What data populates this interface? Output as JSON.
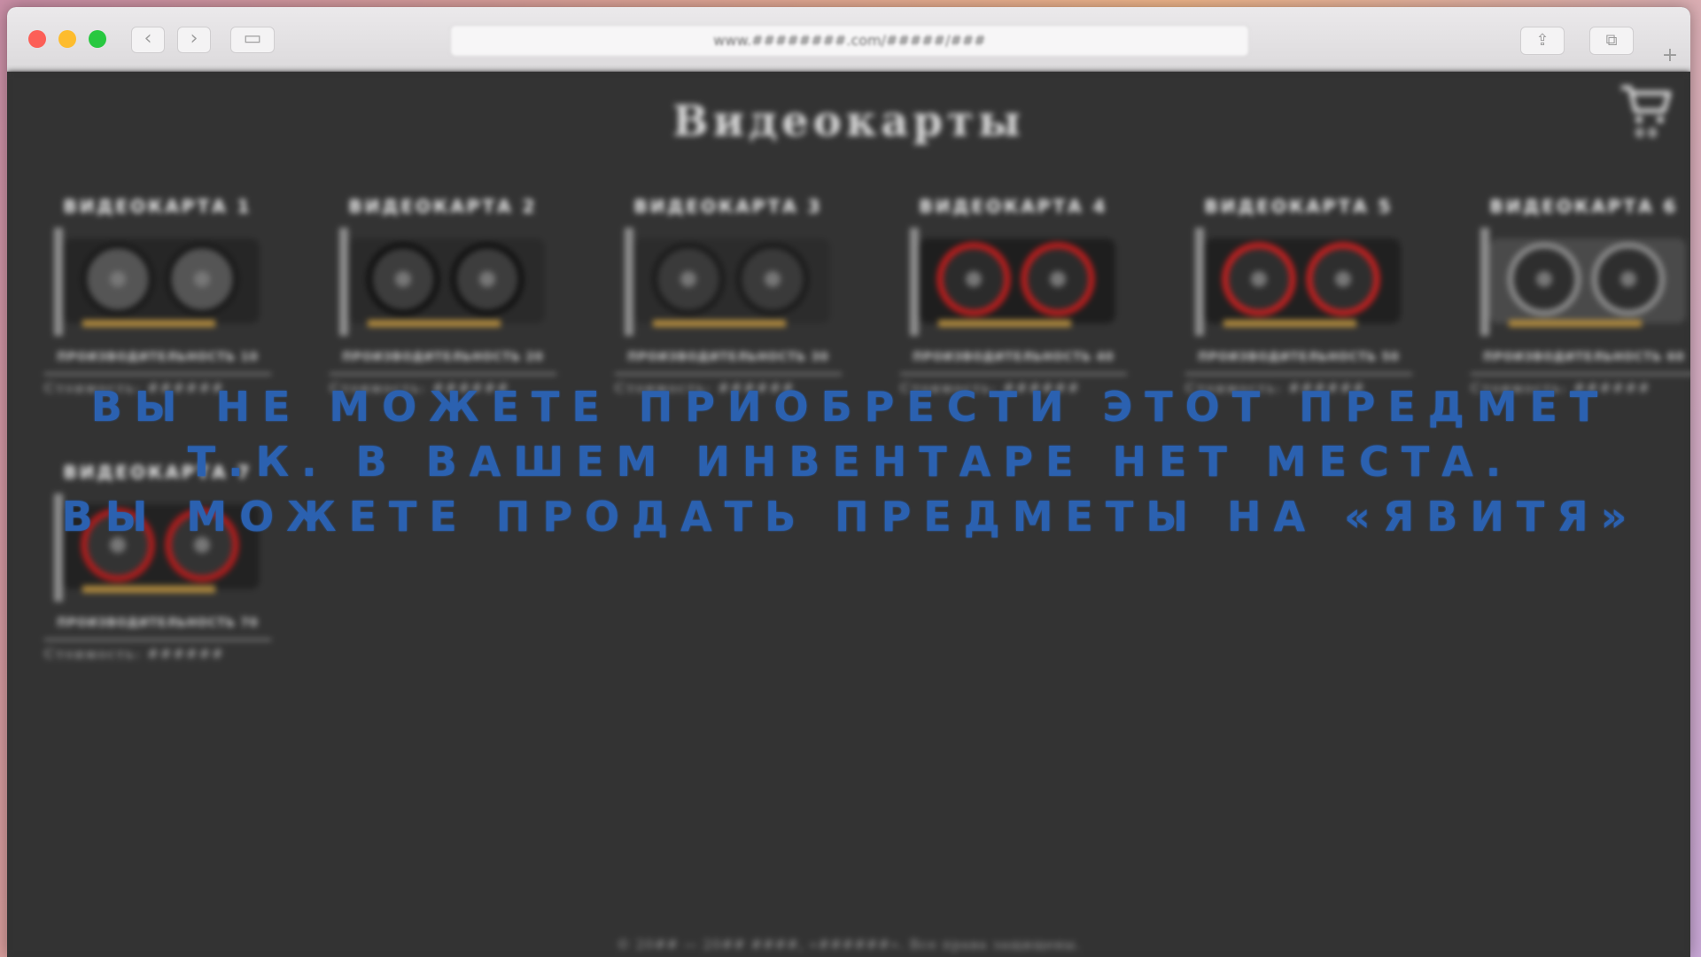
{
  "browser": {
    "url": "www.########.com/#####/###",
    "back_icon": "‹",
    "forward_icon": "›",
    "sidebar_icon": "▭",
    "share_icon": "⇪",
    "tabs_icon": "⧉",
    "newtab_icon": "+"
  },
  "page": {
    "title": "Видеокарты",
    "cart": {
      "count": "0 0"
    },
    "cards": [
      {
        "title": "Видеокарта 1",
        "performance": "Производительность 10",
        "price": "Стоимость: ######",
        "image": {
          "body": "#262626",
          "accent": "#1a1a1a",
          "fan": "#555555"
        }
      },
      {
        "title": "Видеокарта 2",
        "performance": "Производительность 20",
        "price": "Стоимость: ######",
        "image": {
          "body": "#2a2a2a",
          "accent": "#111111",
          "fan": "#3d3d3d"
        }
      },
      {
        "title": "Видеокарта 3",
        "performance": "Производительность 30",
        "price": "Стоимость: ######",
        "image": {
          "body": "#2c2c2c",
          "accent": "#1c1c1c",
          "fan": "#3a3a3a"
        }
      },
      {
        "title": "Видеокарта 4",
        "performance": "Производительность 40",
        "price": "Стоимость: ######",
        "image": {
          "body": "#1e1e1e",
          "accent": "#c21d1d",
          "fan": "#2b2b2b"
        }
      },
      {
        "title": "Видеокарта 5",
        "performance": "Производительность 50",
        "price": "Стоимость: ######",
        "image": {
          "body": "#202020",
          "accent": "#c82020",
          "fan": "#2e2e2e"
        }
      },
      {
        "title": "Видеокарта 6",
        "performance": "Производительность 60",
        "price": "Стоимость: ######",
        "image": {
          "body": "#4a4a4a",
          "accent": "#8a8a8a",
          "fan": "#2e2e2e"
        }
      },
      {
        "title": "Видеокарта 7",
        "performance": "Производительность 70",
        "price": "Стоимость: ######",
        "image": {
          "body": "#222222",
          "accent": "#b81c1c",
          "fan": "#333333"
        }
      }
    ],
    "footer": "© 20## — 20## ####, «######». Все права защищены."
  },
  "warning": {
    "line1": "Вы не можете приобрести этот предмет",
    "line2": "т.к. в вашем инвентаре нет места.",
    "line3": "Вы можете продать предметы на «Явитя»",
    "color": "#2b61b0"
  }
}
